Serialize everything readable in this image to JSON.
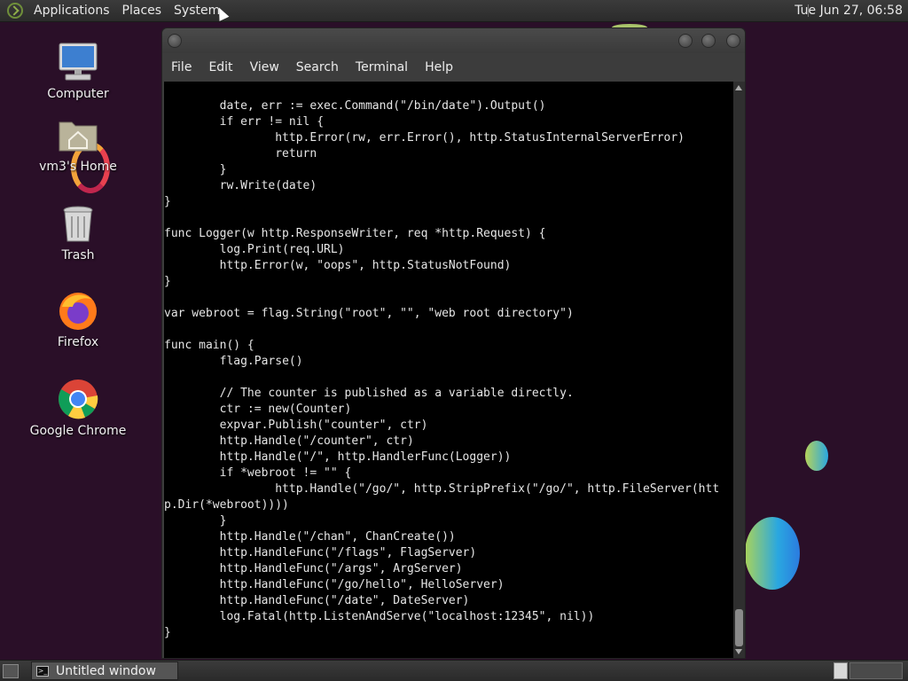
{
  "top_panel": {
    "menus": [
      "Applications",
      "Places",
      "System"
    ],
    "clock": "Tue Jun 27, 06:58"
  },
  "desktop_icons": [
    {
      "label": "Computer",
      "icon": "computer-icon"
    },
    {
      "label": "vm3's Home",
      "icon": "home-folder-icon"
    },
    {
      "label": "Trash",
      "icon": "trash-icon"
    },
    {
      "label": "Firefox",
      "icon": "firefox-icon"
    },
    {
      "label": "Google Chrome",
      "icon": "chrome-icon"
    }
  ],
  "terminal": {
    "menu": [
      "File",
      "Edit",
      "View",
      "Search",
      "Terminal",
      "Help"
    ],
    "lines": [
      "\tdate, err := exec.Command(\"/bin/date\").Output()",
      "\tif err != nil {",
      "\t\thttp.Error(rw, err.Error(), http.StatusInternalServerError)",
      "\t\treturn",
      "\t}",
      "\trw.Write(date)",
      "}",
      "",
      "func Logger(w http.ResponseWriter, req *http.Request) {",
      "\tlog.Print(req.URL)",
      "\thttp.Error(w, \"oops\", http.StatusNotFound)",
      "}",
      "",
      "var webroot = flag.String(\"root\", \"\", \"web root directory\")",
      "",
      "func main() {",
      "\tflag.Parse()",
      "",
      "\t// The counter is published as a variable directly.",
      "\tctr := new(Counter)",
      "\texpvar.Publish(\"counter\", ctr)",
      "\thttp.Handle(\"/counter\", ctr)",
      "\thttp.Handle(\"/\", http.HandlerFunc(Logger))",
      "\tif *webroot != \"\" {",
      "\t\thttp.Handle(\"/go/\", http.StripPrefix(\"/go/\", http.FileServer(htt",
      "p.Dir(*webroot))))",
      "\t}",
      "\thttp.Handle(\"/chan\", ChanCreate())",
      "\thttp.HandleFunc(\"/flags\", FlagServer)",
      "\thttp.HandleFunc(\"/args\", ArgServer)",
      "\thttp.HandleFunc(\"/go/hello\", HelloServer)",
      "\thttp.HandleFunc(\"/date\", DateServer)",
      "\tlog.Fatal(http.ListenAndServe(\"localhost:12345\", nil))",
      "}"
    ]
  },
  "taskbar": {
    "task_label": "Untitled window"
  }
}
